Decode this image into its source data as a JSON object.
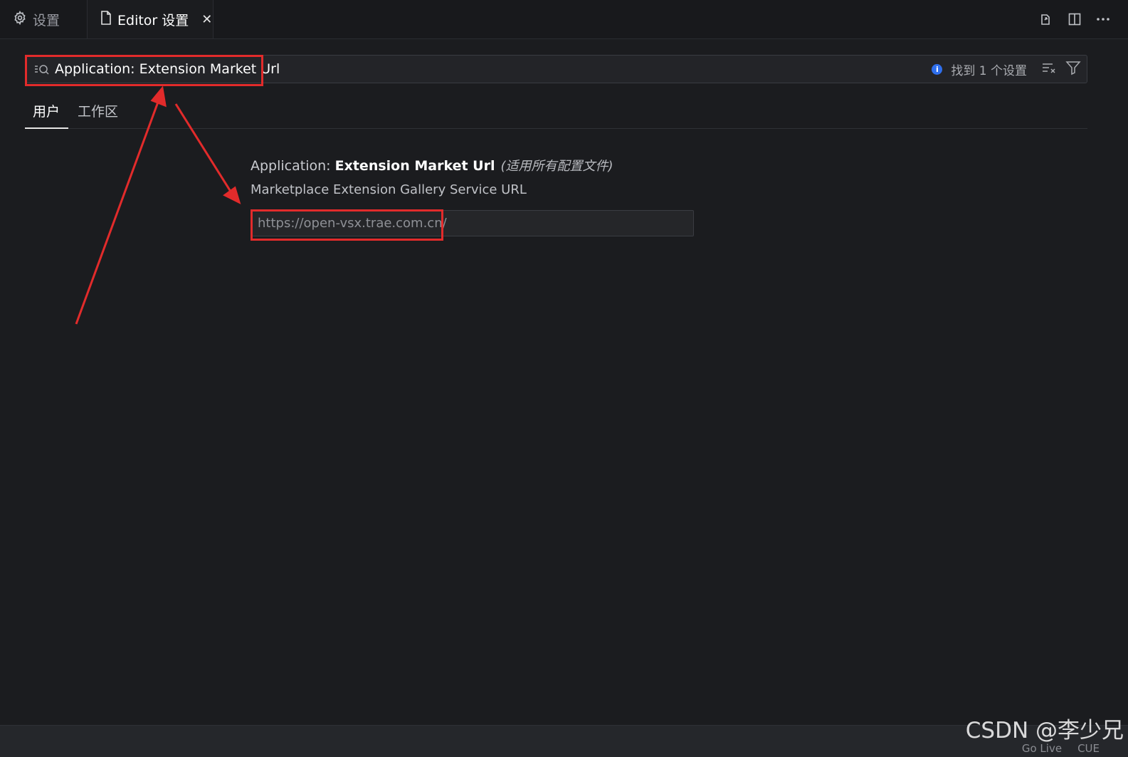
{
  "tabs": [
    {
      "label": "设置",
      "icon": "gear-icon",
      "active": false
    },
    {
      "label": "Editor 设置",
      "icon": "file-icon",
      "active": true,
      "close": "✕"
    }
  ],
  "tab_actions": [
    "open-json-icon",
    "split-editor-icon",
    "more-icon"
  ],
  "search": {
    "value": "Application: Extension Market Url",
    "result": "找到 1 个设置"
  },
  "scope_tabs": [
    {
      "label": "用户",
      "active": true
    },
    {
      "label": "工作区",
      "active": false
    }
  ],
  "setting": {
    "category": "Application: ",
    "name": "Extension Market Url",
    "scope_note": "(适用所有配置文件)",
    "description": "Marketplace Extension Gallery Service URL",
    "value": "https://open-vsx.trae.com.cn/"
  },
  "statusbar": {
    "items": [
      "Go Live",
      "CUE"
    ]
  },
  "watermark": "CSDN @李少兄",
  "colors": {
    "highlight": "#e22b2b",
    "info": "#2f6fed",
    "background": "#1b1c1f"
  }
}
